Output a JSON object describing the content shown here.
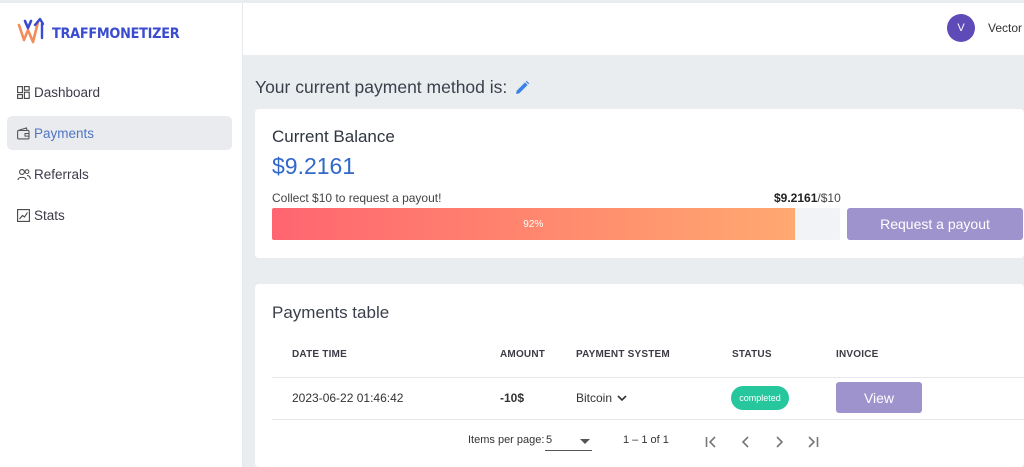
{
  "brand": {
    "name": "TRAFFMONETIZER"
  },
  "sidebar": {
    "items": [
      {
        "label": "Dashboard",
        "icon": "dashboard-icon",
        "active": false
      },
      {
        "label": "Payments",
        "icon": "wallet-icon",
        "active": true
      },
      {
        "label": "Referrals",
        "icon": "users-icon",
        "active": false
      },
      {
        "label": "Stats",
        "icon": "chart-icon",
        "active": false
      }
    ]
  },
  "header": {
    "avatar_initial": "V",
    "username": "Vector"
  },
  "payment_method": {
    "title": "Your current payment method is:",
    "icon": "pencil-icon"
  },
  "balance": {
    "label": "Current Balance",
    "value": "$9.2161",
    "collect_note": "Collect $10 to request a payout!",
    "ratio_current": "$9.2161",
    "ratio_target": "/$10",
    "progress_percent": 92,
    "progress_label": "92%",
    "request_button": "Request a payout"
  },
  "payments_table": {
    "title": "Payments table",
    "columns": [
      "DATE TIME",
      "AMOUNT",
      "PAYMENT SYSTEM",
      "STATUS",
      "INVOICE"
    ],
    "rows": [
      {
        "datetime": "2023-06-22 01:46:42",
        "amount": "-10$",
        "system": "Bitcoin",
        "status": "completed",
        "invoice": "View"
      }
    ]
  },
  "pagination": {
    "items_per_page_label": "Items per page:",
    "items_per_page": "5",
    "range": "1 – 1 of 1"
  },
  "colors": {
    "accent": "#3168c9",
    "button": "#9f93cd",
    "status_completed": "#26c79c",
    "avatar": "#5e4bb8",
    "brand": "#3a4bd1",
    "progress_start": "#ff6570",
    "progress_end": "#ffa970"
  }
}
